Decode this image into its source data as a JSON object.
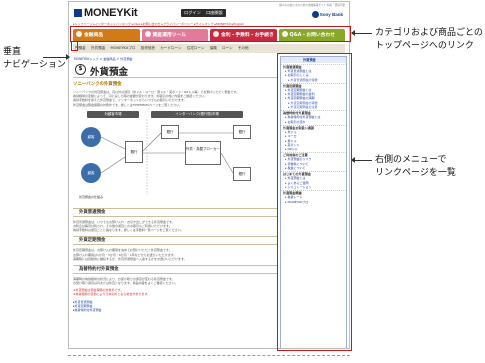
{
  "header": {
    "logo_text": "MONEYKit",
    "login_label": "ログイン",
    "open_account_label": "口座開設",
    "top_note": "個人のお客さまのための金融情報サイト 有料・登録不要",
    "brand": "Sony Bank"
  },
  "sublinks": "▸トップページ ▸インターネットバンキング ▸Q&A ▸お問い合わせ ▸プライバシーポリシー ▸サイトマップ ▸MONEYKit ▸English",
  "global_nav": [
    {
      "label": "金融商品",
      "color": "#d27a18"
    },
    {
      "label": "資産運用ツール",
      "color": "#e07b9a"
    },
    {
      "label": "金利・手数料・お手続き",
      "color": "#c9283e"
    },
    {
      "label": "Q&A・お問い合わせ",
      "color": "#8aa728"
    }
  ],
  "sub_nav": [
    "円預金",
    "外貨預金",
    "MONEYKitプロ",
    "投資信託",
    "カードローン",
    "住宅ローン",
    "保険",
    "ローン",
    "その他"
  ],
  "breadcrumb": "MONEYKitトップ > 金融商品 > 外貨預金",
  "page": {
    "title": "外貨預金",
    "lead": "ソニーバンクの外貨預金",
    "intro_lines": [
      "ソニーバンクの外貨預金は、円以外の通貨（米ドル・ユーロ・豪ドル・英ポンド・NZドル等）でお預けいただく預金です。",
      "為替相場の変動によって、円に戻した時の金額が変わります。お取引の前に内容をご確認ください。",
      "為替手数料を抑えた外貨預金で、インターネットからいつでもお取引いただけます。",
      "外貨預金は預金保険の対象外です。詳しくはTIMEMEMOページをご覧ください。"
    ],
    "diagram": {
      "left_label": "対顧客市場",
      "right_label": "インターバンク(銀行間)市場",
      "customer_a": "顧客",
      "customer_b": "顧客",
      "bank_a": "銀行",
      "bank_b": "銀行",
      "broker": "外貨・為替ブローカー",
      "bank_c": "銀行",
      "bank_d": "銀行",
      "caption": "外貨預金の仕組み"
    },
    "section1": "外貨普通預金",
    "section1_lines": [
      "外貨普通預金は、いつでもお預け入れ・お引き出しができる外貨預金です。",
      "お利息は毎月付利され、その他の通貨とのお取引もご利用いただけます。",
      "為替手数料は通貨ごとに異なります。詳しくは手数料一覧ページをご覧ください。"
    ],
    "section2": "外貨定期預金",
    "section2_lines": [
      "外貨定期預金は、お預け入れ期間を決めてお預けいただく外貨預金です。",
      "お預け入れ期間は1か月・3か月・6か月・1年などからお選びいただけます。",
      "満期時には自動的に継続するか、外貨普通預金へ入金するかをお選びいただけます。"
    ],
    "section3": "為替特約付外貨預金",
    "section3_lines": [
      "満期時の為替相場の状況により、お受け取りの通貨が変わる外貨預金です。",
      "お受け取り通貨は円または外貨となります。商品内容をよくご確認ください。"
    ],
    "notes_red": [
      "※外貨預金は預金保険の対象外です。",
      "※為替相場の変動により元本割れとなる場合があります。"
    ],
    "links_blue": [
      "▸外貨普通預金",
      "▸外貨定期預金",
      "▸為替特約付外貨預金"
    ]
  },
  "sidebar": {
    "header": "外貨預金",
    "groups": [
      {
        "title": "外貨普通預金",
        "items": [
          "外貨普通預金とは",
          "お取引のしくみ"
        ],
        "sub": [
          "外貨普通預金の特徴"
        ]
      },
      {
        "title": "外貨定期預金",
        "items": [
          "外貨定期預金とは",
          "外貨定期預金の金利",
          "外貨定期預金の満期"
        ],
        "sub": [
          "外貨定期預金の特徴",
          "外貨定期預金の注意"
        ]
      },
      {
        "title": "為替特約付外貨預金",
        "items": [
          "為替特約付外貨預金とは",
          "お取引の流れ"
        ],
        "sub": []
      },
      {
        "title": "外貨預金お取扱い通貨",
        "items": [
          "米ドル",
          "ユーロ",
          "豪ドル",
          "英ポンド",
          "NZドル"
        ],
        "sub": []
      },
      {
        "title": "ご利用前のご注意",
        "items": [
          "外貨預金のリスク",
          "手数料について",
          "税金について"
        ],
        "sub": []
      },
      {
        "title": "はじめての外貨預金",
        "items": [
          "外貨預金とは",
          "よくあるご質問",
          "シミュレーション"
        ],
        "sub": []
      },
      {
        "title": "外貨預金関連",
        "items": [
          "為替レート",
          "MONEYKitプロ"
        ],
        "sub": []
      }
    ]
  },
  "annotations": {
    "left": [
      "垂直",
      "ナビゲーション"
    ],
    "right_top": [
      "カテゴリおよび商品ごとの",
      "トップページへのリンク"
    ],
    "right_bottom": [
      "右側のメニューで",
      "リンクページを一覧"
    ]
  }
}
